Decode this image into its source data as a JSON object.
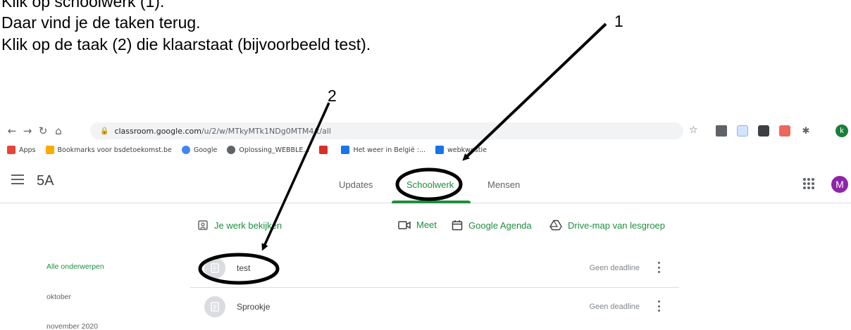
{
  "instructions": {
    "line1": "Klik op schoolwerk (1).",
    "line2": "Daar vind je de taken terug.",
    "line3": "Klik op de taak (2) die klaarstaat (bijvoorbeeld test)."
  },
  "callouts": {
    "one": "1",
    "two": "2"
  },
  "browser": {
    "url_host": "classroom.google.com",
    "url_path": "/u/2/w/MTkyMTk1NDg0MTM4/t/all",
    "profile_initial": "k",
    "bookmarks": [
      {
        "label": "Apps",
        "icon": "apps-grid-icon",
        "color": "#ea4335"
      },
      {
        "label": "Bookmarks voor bsdetoekomst.be",
        "icon": "folder-icon",
        "color": "#f9ab00"
      },
      {
        "label": "Google",
        "icon": "google-icon",
        "color": "#4285f4"
      },
      {
        "label": "Oplossing_WEBBLE...",
        "icon": "globe-icon",
        "color": "#5f6368"
      },
      {
        "label": "",
        "icon": "pdf-icon",
        "color": "#d93025"
      },
      {
        "label": "Het weer in België :...",
        "icon": "weather-icon",
        "color": "#1a73e8"
      },
      {
        "label": "webkwestie",
        "icon": "doc-icon",
        "color": "#1a73e8"
      }
    ]
  },
  "classroom": {
    "class_name": "5A",
    "tabs": {
      "updates": "Updates",
      "classwork": "Schoolwerk",
      "people": "Mensen"
    },
    "user_initial": "M",
    "actions": {
      "view_work": "Je werk bekijken",
      "meet": "Meet",
      "calendar": "Google Agenda",
      "drive": "Drive-map van lesgroep"
    },
    "topics": [
      "Alle onderwerpen",
      "oktober",
      "november 2020"
    ],
    "assignments": [
      {
        "title": "test",
        "due": "Geen deadline"
      },
      {
        "title": "Sprookje",
        "due": "Geen deadline"
      }
    ]
  },
  "colors": {
    "accent": "#1e8e3e",
    "avatar": "#8e24aa"
  }
}
